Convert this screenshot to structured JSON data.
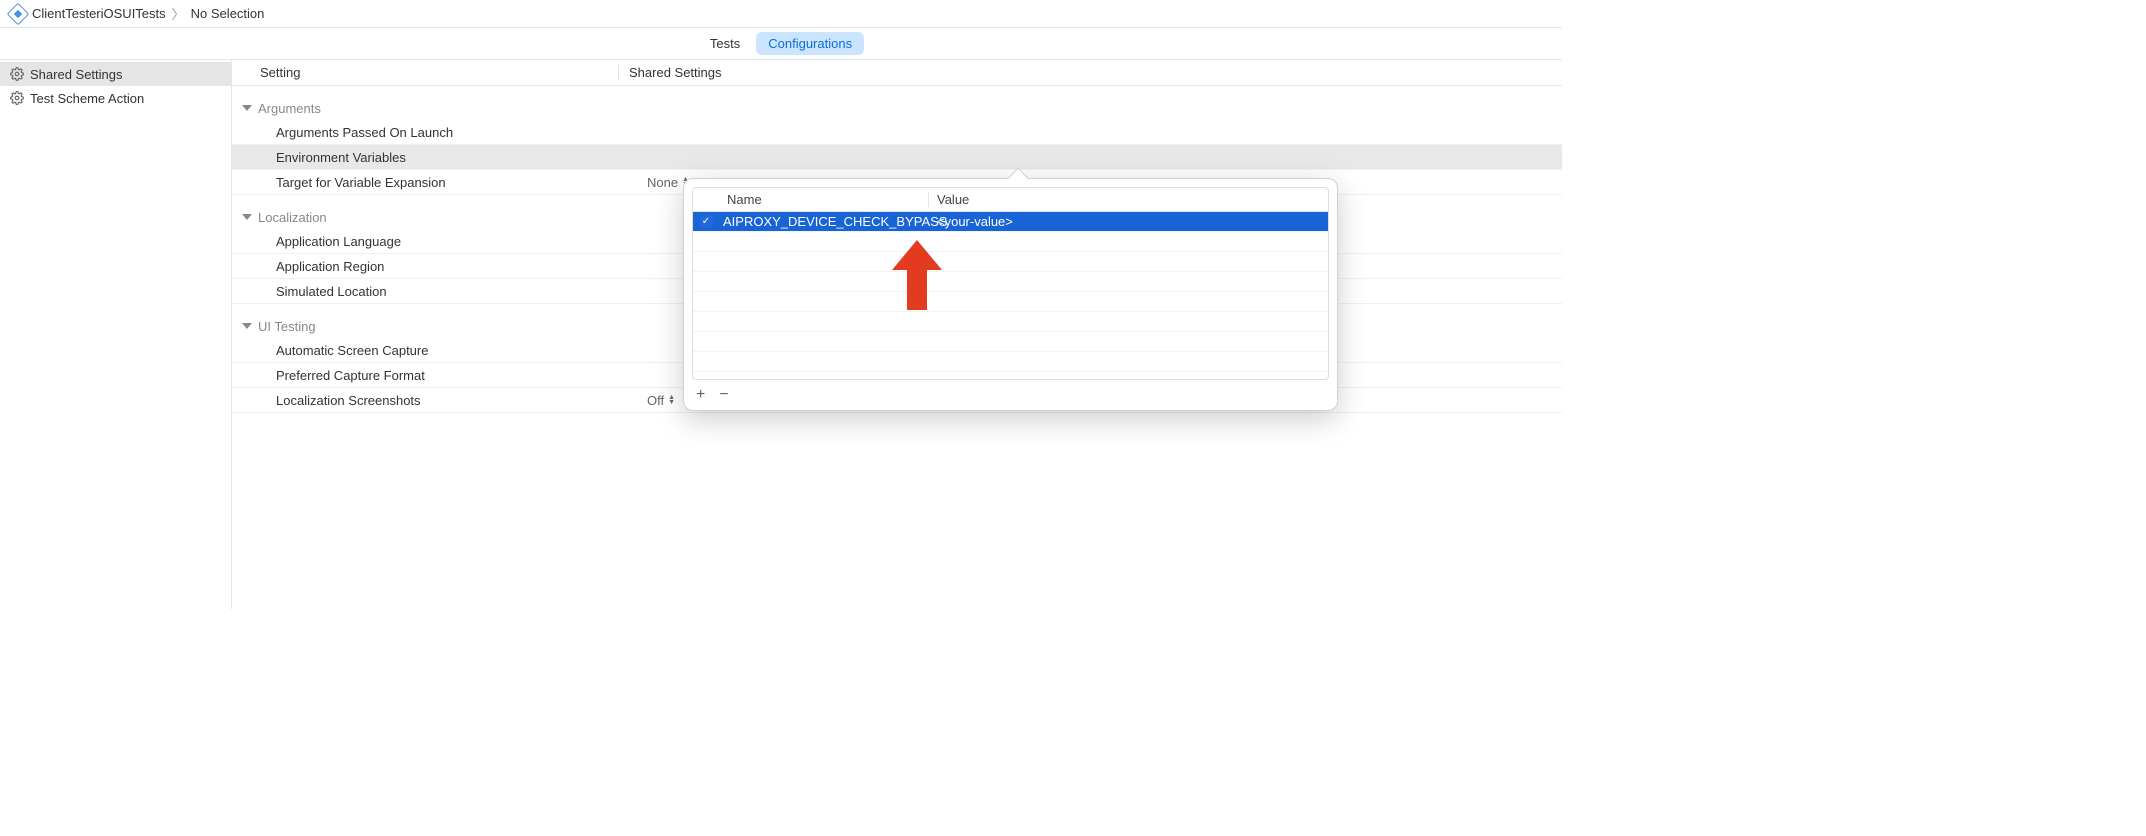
{
  "breadcrumb": {
    "project": "ClientTesteriOSUITests",
    "selection": "No Selection"
  },
  "tabs": {
    "tests": "Tests",
    "configurations": "Configurations"
  },
  "sidebar": {
    "items": [
      {
        "label": "Shared Settings",
        "selected": true
      },
      {
        "label": "Test Scheme Action",
        "selected": false
      }
    ]
  },
  "content": {
    "header": {
      "col1": "Setting",
      "col2": "Shared Settings"
    },
    "sections": [
      {
        "title": "Arguments",
        "rows": [
          {
            "label": "Arguments Passed On Launch",
            "value": ""
          },
          {
            "label": "Environment Variables",
            "value": "",
            "highlighted": true
          },
          {
            "label": "Target for Variable Expansion",
            "value": "None",
            "hasUpDown": true
          }
        ]
      },
      {
        "title": "Localization",
        "rows": [
          {
            "label": "Application Language",
            "value": ""
          },
          {
            "label": "Application Region",
            "value": ""
          },
          {
            "label": "Simulated Location",
            "value": ""
          }
        ]
      },
      {
        "title": "UI Testing",
        "rows": [
          {
            "label": "Automatic Screen Capture",
            "value": ""
          },
          {
            "label": "Preferred Capture Format",
            "value": ""
          },
          {
            "label": "Localization Screenshots",
            "value": "Off",
            "hasUpDown": true
          }
        ]
      }
    ]
  },
  "popover": {
    "columns": {
      "name": "Name",
      "value": "Value"
    },
    "rows": [
      {
        "checked": true,
        "name": "AIPROXY_DEVICE_CHECK_BYPASS",
        "value": "<your-value>",
        "selected": true
      }
    ],
    "footer": {
      "add": "+",
      "remove": "−"
    }
  },
  "annotation": {
    "color": "#e23b1f"
  }
}
